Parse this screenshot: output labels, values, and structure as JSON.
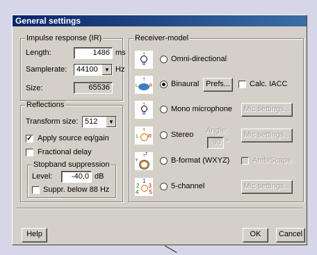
{
  "title": "General settings",
  "impulse": {
    "label": "Impulse response (IR)",
    "length_label": "Length:",
    "length_value": "1486",
    "length_unit": "ms",
    "samplerate_label": "Samplerate:",
    "samplerate_value": "44100",
    "samplerate_unit": "Hz",
    "size_label": "Size:",
    "size_value": "65536"
  },
  "reflections": {
    "label": "Reflections",
    "transform_label": "Transform size:",
    "transform_value": "512",
    "apply_eq_label": "Apply source eq/gain",
    "fractional_label": "Fractional delay",
    "stopband": {
      "label": "Stopband suppression",
      "level_label": "Level:",
      "level_value": "-40,0",
      "level_unit": "dB",
      "suppr_label": "Suppr. below 88 Hz"
    }
  },
  "receiver": {
    "label": "Receiver-model",
    "omni": "Omni-directional",
    "binaural": "Binaural",
    "prefs": "Prefs...",
    "calc_iacc": "Calc. IACC",
    "mono": "Mono microphone",
    "mic_settings": "Mic settings...",
    "stereo": "Stereo",
    "angle_label": "Angle:",
    "angle_value": "90",
    "angle_unit": "°",
    "bformat": "B-format (WXYZ)",
    "ambiscape": "AmbiScape",
    "five_channel": "5-channel",
    "selected": "Binaural"
  },
  "buttons": {
    "help": "Help",
    "ok": "OK",
    "cancel": "Cancel"
  },
  "icons": {
    "omni": {
      "top": "↑",
      "bottom": "M"
    },
    "binaural": {
      "top": "↑",
      "left": "L",
      "right": "R"
    },
    "mono": {
      "top": "↑",
      "bottom": "M"
    },
    "stereo": {
      "top": "↑",
      "left": "L",
      "right": "R"
    },
    "bformat": {
      "top": "↑",
      "mark": "Z",
      "side": "Y"
    },
    "five": {
      "n1": "1",
      "n2": "2",
      "n3": "3",
      "n4": "4",
      "n5": "5"
    }
  }
}
